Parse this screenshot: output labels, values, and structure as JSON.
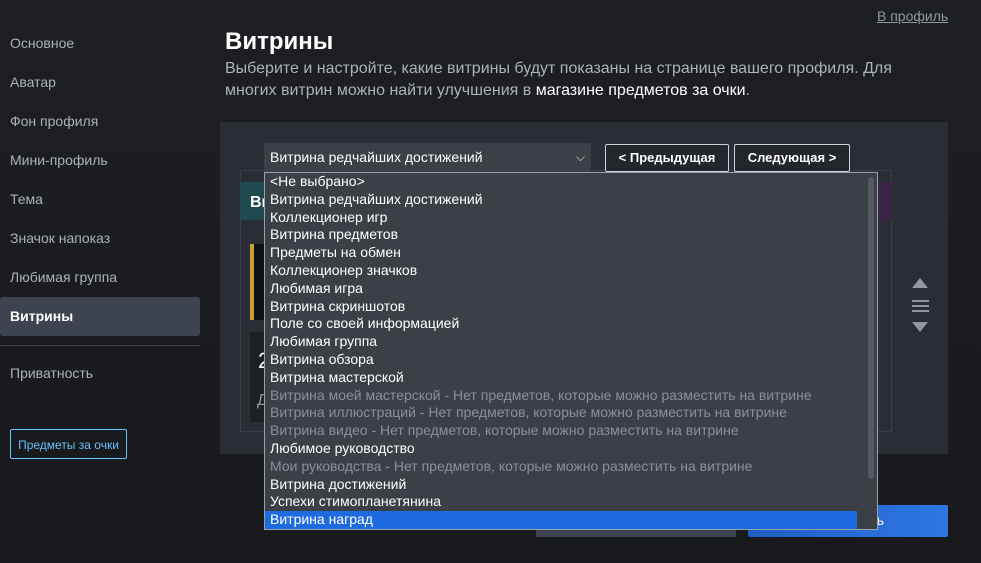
{
  "top_link": "В профиль",
  "sidebar": {
    "items": [
      {
        "label": "Основное"
      },
      {
        "label": "Аватар"
      },
      {
        "label": "Фон профиля"
      },
      {
        "label": "Мини-профиль"
      },
      {
        "label": "Тема"
      },
      {
        "label": "Значок напоказ"
      },
      {
        "label": "Любимая группа"
      },
      {
        "label": "Витрины"
      }
    ],
    "privacy": "Приватность",
    "points_button": "Предметы за очки"
  },
  "header": {
    "title": "Витрины",
    "desc_part1": "Выберите и настройте, какие витрины будут показаны на странице вашего профиля. Для многих витрин можно найти улучшения в ",
    "desc_link": "магазине предметов за очки",
    "desc_part2": "."
  },
  "showcase": {
    "select_value": "Витрина редчайших достижений",
    "prev": "< Предыдущая",
    "next": "Следующая >",
    "card_head": "Ви",
    "stat_num": "2",
    "stat_lbl": "Д"
  },
  "dropdown": {
    "options": [
      {
        "label": "<Не выбрано>",
        "state": "normal"
      },
      {
        "label": "Витрина редчайших достижений",
        "state": "normal"
      },
      {
        "label": "Коллекционер игр",
        "state": "normal"
      },
      {
        "label": "Витрина предметов",
        "state": "normal"
      },
      {
        "label": "Предметы на обмен",
        "state": "normal"
      },
      {
        "label": "Коллекционер значков",
        "state": "normal"
      },
      {
        "label": "Любимая игра",
        "state": "normal"
      },
      {
        "label": "Витрина скриншотов",
        "state": "normal"
      },
      {
        "label": "Поле со своей информацией",
        "state": "normal"
      },
      {
        "label": "Любимая группа",
        "state": "normal"
      },
      {
        "label": "Витрина обзора",
        "state": "normal"
      },
      {
        "label": "Витрина мастерской",
        "state": "normal"
      },
      {
        "label": "Витрина моей мастерской - Нет предметов, которые можно разместить на витрине",
        "state": "disabled"
      },
      {
        "label": "Витрина иллюстраций - Нет предметов, которые можно разместить на витрине",
        "state": "disabled"
      },
      {
        "label": "Витрина видео - Нет предметов, которые можно разместить на витрине",
        "state": "disabled"
      },
      {
        "label": "Любимое руководство",
        "state": "normal"
      },
      {
        "label": "Мои руководства - Нет предметов, которые можно разместить на витрине",
        "state": "disabled"
      },
      {
        "label": "Витрина достижений",
        "state": "normal"
      },
      {
        "label": "Успехи стимопланетянина",
        "state": "normal"
      },
      {
        "label": "Витрина наград",
        "state": "selected"
      }
    ]
  },
  "footer": {
    "save_tail": "ь"
  },
  "colors": {
    "accent": "#1e6be0",
    "link": "#66c0f4",
    "panel": "#2a2e34"
  }
}
